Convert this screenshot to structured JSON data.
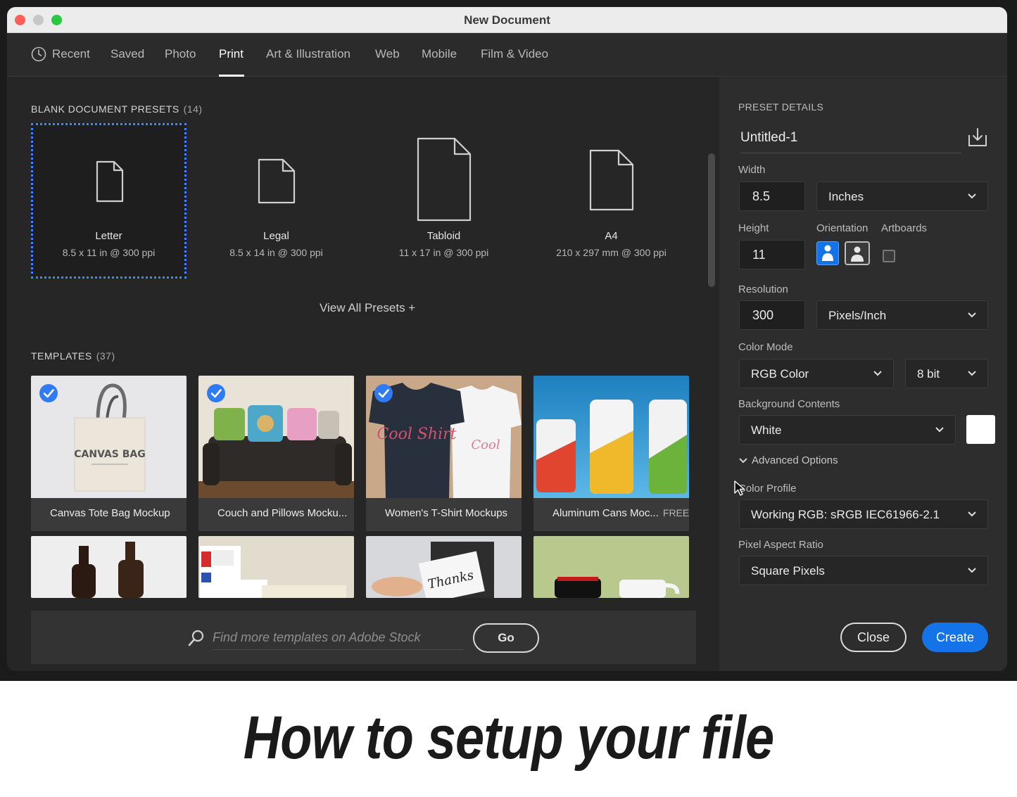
{
  "window": {
    "title": "New Document"
  },
  "nav": {
    "tabs": [
      {
        "label": "Recent",
        "icon": "clock-icon"
      },
      {
        "label": "Saved"
      },
      {
        "label": "Photo"
      },
      {
        "label": "Print",
        "active": true
      },
      {
        "label": "Art & Illustration"
      },
      {
        "label": "Web"
      },
      {
        "label": "Mobile"
      },
      {
        "label": "Film & Video"
      }
    ]
  },
  "presets": {
    "heading": "BLANK DOCUMENT PRESETS",
    "count": "(14)",
    "items": [
      {
        "name": "Letter",
        "dims": "8.5 x 11 in @ 300 ppi",
        "selected": true
      },
      {
        "name": "Legal",
        "dims": "8.5 x 14 in @ 300 ppi"
      },
      {
        "name": "Tabloid",
        "dims": "11 x 17 in @ 300 ppi"
      },
      {
        "name": "A4",
        "dims": "210 x 297 mm @ 300 ppi"
      }
    ],
    "view_all": "View All Presets +"
  },
  "templates": {
    "heading": "TEMPLATES",
    "count": "(37)",
    "items": [
      {
        "name": "Canvas Tote Bag Mockup",
        "checked": true,
        "thumb_text": "CANVAS BAG"
      },
      {
        "name": "Couch and Pillows Mocku...",
        "checked": true
      },
      {
        "name": "Women's T-Shirt Mockups",
        "checked": true,
        "thumb_text": "Cool Shirt"
      },
      {
        "name": "Aluminum Cans Moc...",
        "badge": "FREE"
      }
    ]
  },
  "stock_search": {
    "placeholder": "Find more templates on Adobe Stock",
    "go_label": "Go"
  },
  "details": {
    "heading": "PRESET DETAILS",
    "doc_name": "Untitled-1",
    "width_label": "Width",
    "width_value": "8.5",
    "width_unit": "Inches",
    "height_label": "Height",
    "height_value": "11",
    "orientation_label": "Orientation",
    "artboards_label": "Artboards",
    "resolution_label": "Resolution",
    "resolution_value": "300",
    "resolution_unit": "Pixels/Inch",
    "color_mode_label": "Color Mode",
    "color_mode_value": "RGB Color",
    "bit_depth": "8 bit",
    "background_label": "Background Contents",
    "background_value": "White",
    "advanced_label": "Advanced Options",
    "color_profile_label": "Color Profile",
    "color_profile_value": "Working RGB: sRGB IEC61966-2.1",
    "pixel_aspect_label": "Pixel Aspect Ratio",
    "pixel_aspect_value": "Square Pixels",
    "close_label": "Close",
    "create_label": "Create"
  },
  "caption": "How to setup your file",
  "colors": {
    "accent": "#1473e6",
    "selection": "#3f86ff",
    "check": "#2f7bf5"
  }
}
